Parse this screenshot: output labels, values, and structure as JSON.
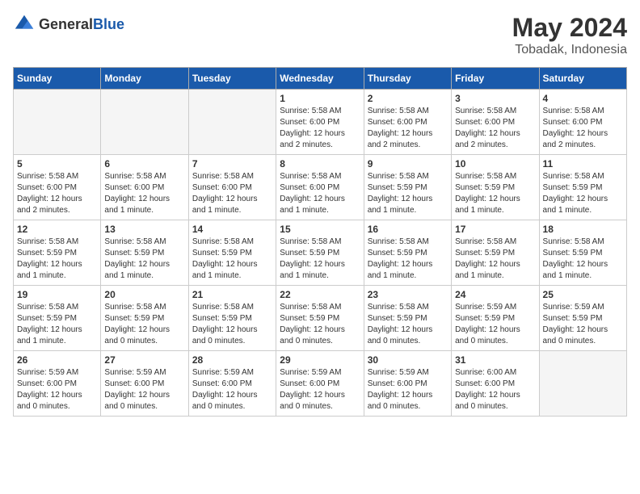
{
  "header": {
    "logo_general": "General",
    "logo_blue": "Blue",
    "month_title": "May 2024",
    "location": "Tobadak, Indonesia"
  },
  "days_of_week": [
    "Sunday",
    "Monday",
    "Tuesday",
    "Wednesday",
    "Thursday",
    "Friday",
    "Saturday"
  ],
  "weeks": [
    [
      {
        "day": "",
        "info": ""
      },
      {
        "day": "",
        "info": ""
      },
      {
        "day": "",
        "info": ""
      },
      {
        "day": "1",
        "info": "Sunrise: 5:58 AM\nSunset: 6:00 PM\nDaylight: 12 hours\nand 2 minutes."
      },
      {
        "day": "2",
        "info": "Sunrise: 5:58 AM\nSunset: 6:00 PM\nDaylight: 12 hours\nand 2 minutes."
      },
      {
        "day": "3",
        "info": "Sunrise: 5:58 AM\nSunset: 6:00 PM\nDaylight: 12 hours\nand 2 minutes."
      },
      {
        "day": "4",
        "info": "Sunrise: 5:58 AM\nSunset: 6:00 PM\nDaylight: 12 hours\nand 2 minutes."
      }
    ],
    [
      {
        "day": "5",
        "info": "Sunrise: 5:58 AM\nSunset: 6:00 PM\nDaylight: 12 hours\nand 2 minutes."
      },
      {
        "day": "6",
        "info": "Sunrise: 5:58 AM\nSunset: 6:00 PM\nDaylight: 12 hours\nand 1 minute."
      },
      {
        "day": "7",
        "info": "Sunrise: 5:58 AM\nSunset: 6:00 PM\nDaylight: 12 hours\nand 1 minute."
      },
      {
        "day": "8",
        "info": "Sunrise: 5:58 AM\nSunset: 6:00 PM\nDaylight: 12 hours\nand 1 minute."
      },
      {
        "day": "9",
        "info": "Sunrise: 5:58 AM\nSunset: 5:59 PM\nDaylight: 12 hours\nand 1 minute."
      },
      {
        "day": "10",
        "info": "Sunrise: 5:58 AM\nSunset: 5:59 PM\nDaylight: 12 hours\nand 1 minute."
      },
      {
        "day": "11",
        "info": "Sunrise: 5:58 AM\nSunset: 5:59 PM\nDaylight: 12 hours\nand 1 minute."
      }
    ],
    [
      {
        "day": "12",
        "info": "Sunrise: 5:58 AM\nSunset: 5:59 PM\nDaylight: 12 hours\nand 1 minute."
      },
      {
        "day": "13",
        "info": "Sunrise: 5:58 AM\nSunset: 5:59 PM\nDaylight: 12 hours\nand 1 minute."
      },
      {
        "day": "14",
        "info": "Sunrise: 5:58 AM\nSunset: 5:59 PM\nDaylight: 12 hours\nand 1 minute."
      },
      {
        "day": "15",
        "info": "Sunrise: 5:58 AM\nSunset: 5:59 PM\nDaylight: 12 hours\nand 1 minute."
      },
      {
        "day": "16",
        "info": "Sunrise: 5:58 AM\nSunset: 5:59 PM\nDaylight: 12 hours\nand 1 minute."
      },
      {
        "day": "17",
        "info": "Sunrise: 5:58 AM\nSunset: 5:59 PM\nDaylight: 12 hours\nand 1 minute."
      },
      {
        "day": "18",
        "info": "Sunrise: 5:58 AM\nSunset: 5:59 PM\nDaylight: 12 hours\nand 1 minute."
      }
    ],
    [
      {
        "day": "19",
        "info": "Sunrise: 5:58 AM\nSunset: 5:59 PM\nDaylight: 12 hours\nand 1 minute."
      },
      {
        "day": "20",
        "info": "Sunrise: 5:58 AM\nSunset: 5:59 PM\nDaylight: 12 hours\nand 0 minutes."
      },
      {
        "day": "21",
        "info": "Sunrise: 5:58 AM\nSunset: 5:59 PM\nDaylight: 12 hours\nand 0 minutes."
      },
      {
        "day": "22",
        "info": "Sunrise: 5:58 AM\nSunset: 5:59 PM\nDaylight: 12 hours\nand 0 minutes."
      },
      {
        "day": "23",
        "info": "Sunrise: 5:58 AM\nSunset: 5:59 PM\nDaylight: 12 hours\nand 0 minutes."
      },
      {
        "day": "24",
        "info": "Sunrise: 5:59 AM\nSunset: 5:59 PM\nDaylight: 12 hours\nand 0 minutes."
      },
      {
        "day": "25",
        "info": "Sunrise: 5:59 AM\nSunset: 5:59 PM\nDaylight: 12 hours\nand 0 minutes."
      }
    ],
    [
      {
        "day": "26",
        "info": "Sunrise: 5:59 AM\nSunset: 6:00 PM\nDaylight: 12 hours\nand 0 minutes."
      },
      {
        "day": "27",
        "info": "Sunrise: 5:59 AM\nSunset: 6:00 PM\nDaylight: 12 hours\nand 0 minutes."
      },
      {
        "day": "28",
        "info": "Sunrise: 5:59 AM\nSunset: 6:00 PM\nDaylight: 12 hours\nand 0 minutes."
      },
      {
        "day": "29",
        "info": "Sunrise: 5:59 AM\nSunset: 6:00 PM\nDaylight: 12 hours\nand 0 minutes."
      },
      {
        "day": "30",
        "info": "Sunrise: 5:59 AM\nSunset: 6:00 PM\nDaylight: 12 hours\nand 0 minutes."
      },
      {
        "day": "31",
        "info": "Sunrise: 6:00 AM\nSunset: 6:00 PM\nDaylight: 12 hours\nand 0 minutes."
      },
      {
        "day": "",
        "info": ""
      }
    ]
  ]
}
